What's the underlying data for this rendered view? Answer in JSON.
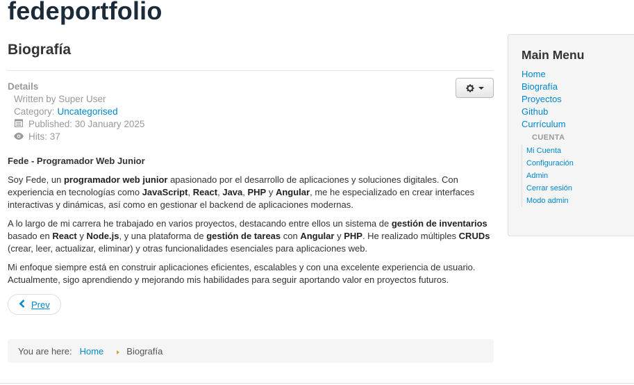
{
  "site": {
    "title": "fedeportfolio"
  },
  "article": {
    "title": "Biografía",
    "details_label": "Details",
    "written_by": "Written by Super User",
    "category_prefix": "Category:",
    "category": "Uncategorised",
    "published": "Published: 30 January 2025",
    "hits": "Hits: 37",
    "heading": "Fede - Programador Web Junior",
    "p1": [
      {
        "t": "Soy Fede, un "
      },
      {
        "t": "programador web junior",
        "b": true
      },
      {
        "t": " apasionado por el desarrollo de aplicaciones y soluciones digitales. Con experiencia en tecnologías como "
      },
      {
        "t": "JavaScript",
        "b": true
      },
      {
        "t": ", "
      },
      {
        "t": "React",
        "b": true
      },
      {
        "t": ", "
      },
      {
        "t": "Java",
        "b": true
      },
      {
        "t": ", "
      },
      {
        "t": "PHP",
        "b": true
      },
      {
        "t": " y "
      },
      {
        "t": "Angular",
        "b": true
      },
      {
        "t": ", me he especializado en crear interfaces interactivas y dinámicas, así como en gestionar el backend de aplicaciones modernas."
      }
    ],
    "p2": [
      {
        "t": "A lo largo de mi carrera he trabajado en varios proyectos, destacando entre ellos un sistema de "
      },
      {
        "t": "gestión de inventarios",
        "b": true
      },
      {
        "t": " basado en "
      },
      {
        "t": "React",
        "b": true
      },
      {
        "t": " y "
      },
      {
        "t": "Node.js",
        "b": true
      },
      {
        "t": ", y una plataforma de "
      },
      {
        "t": "gestión de tareas",
        "b": true
      },
      {
        "t": " con "
      },
      {
        "t": "Angular",
        "b": true
      },
      {
        "t": " y "
      },
      {
        "t": "PHP",
        "b": true
      },
      {
        "t": ". He realizado múltiples "
      },
      {
        "t": "CRUDs",
        "b": true
      },
      {
        "t": " (crear, leer, actualizar, eliminar) y otras funcionalidades esenciales para aplicaciones web."
      }
    ],
    "p3": "Mi enfoque siempre está en construir aplicaciones eficientes, escalables y con una excelente experiencia de usuario. Actualmente, sigo aprendiendo y mejorando mis habilidades para seguir aportando valor en proyectos futuros.",
    "prev_label": "Prev"
  },
  "breadcrumb": {
    "prefix": "You are here:",
    "home": "Home",
    "current": "Biografía"
  },
  "sidebar": {
    "title": "Main Menu",
    "items": [
      "Home",
      "Biografía",
      "Proyectos",
      "Github",
      "Currículum"
    ],
    "sub_header": "CUENTA",
    "sub_items": [
      "Mi Cuenta",
      "Configuración",
      "Admin",
      "Cerrar sesión",
      "Modo admin"
    ]
  },
  "icons": {
    "gear": "gear-icon",
    "calendar": "calendar-icon",
    "eye": "eye-icon",
    "prev": "chevron-left-icon"
  },
  "colors": {
    "link": "#0088cc",
    "title": "#1b2b3a",
    "muted": "#999999"
  }
}
